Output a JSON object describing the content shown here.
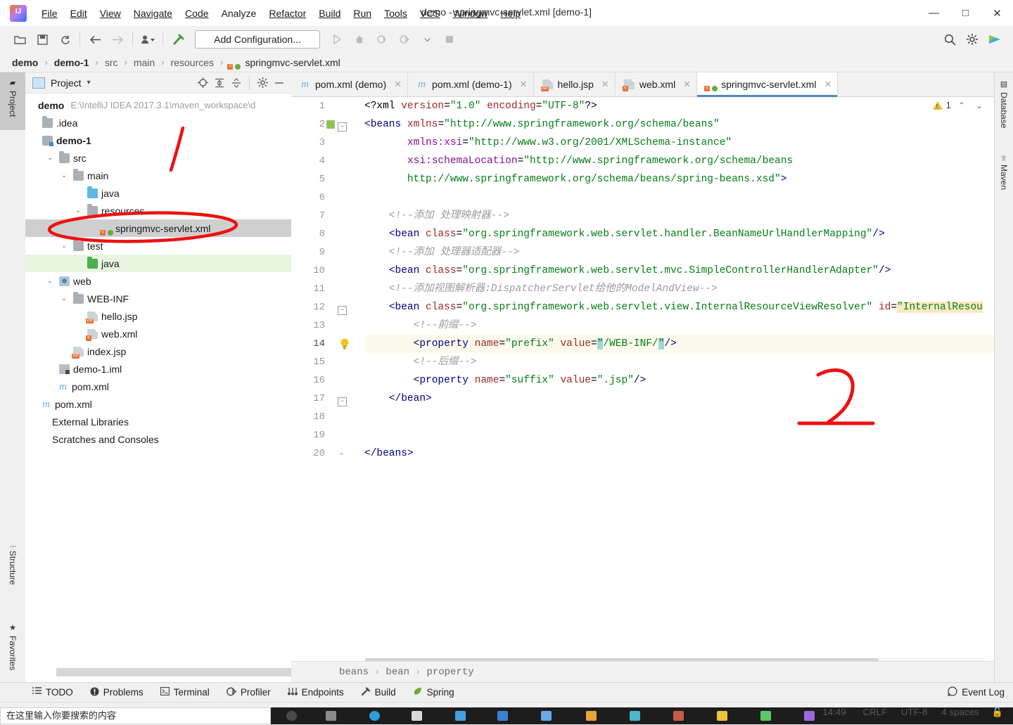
{
  "window": {
    "title": "demo - springmvc-servlet.xml [demo-1]",
    "minimize": "—",
    "maximize": "□",
    "close": "✕",
    "logo_text": "IJ"
  },
  "menubar": {
    "items": [
      "File",
      "Edit",
      "View",
      "Navigate",
      "Code",
      "Analyze",
      "Refactor",
      "Build",
      "Run",
      "Tools",
      "VCS",
      "Window",
      "Help"
    ]
  },
  "toolbar": {
    "open_icon": "open-folder-icon",
    "save_icon": "save-icon",
    "sync_icon": "sync-icon",
    "back_icon": "back-arrow-icon",
    "forward_icon": "forward-arrow-icon",
    "vcs_update_icon": "vcs-update-icon",
    "build_icon": "build-hammer-icon",
    "add_configuration": "Add Configuration...",
    "run_icon": "run-icon",
    "debug_icon": "debug-icon",
    "run_coverage_icon": "run-with-coverage-icon",
    "profile_icon": "profile-icon",
    "stop_icon": "stop-icon",
    "search_icon": "search-icon",
    "settings_icon": "gear-icon",
    "ide_icon": "ide-help-icon"
  },
  "breadcrumbs": {
    "items": [
      "demo",
      "demo-1",
      "src",
      "main",
      "resources",
      "springmvc-servlet.xml"
    ],
    "separator": "›"
  },
  "left_strip": {
    "tabs": [
      {
        "label": "Project",
        "icon": "project-icon",
        "selected": true
      },
      {
        "label": "Structure",
        "icon": "structure-icon",
        "selected": false
      },
      {
        "label": "Favorites",
        "icon": "star-icon",
        "selected": false
      }
    ]
  },
  "right_strip": {
    "tabs": [
      {
        "label": "Database",
        "icon": "database-icon"
      },
      {
        "label": "Maven",
        "icon": "maven-m-icon"
      }
    ]
  },
  "project_panel": {
    "title": "Project",
    "caret": "▾",
    "tools": [
      {
        "name": "select-opened-file-icon",
        "glyph": "⊕"
      },
      {
        "name": "expand-all-icon",
        "glyph": "⏩"
      },
      {
        "name": "collapse-all-icon",
        "glyph": "⏪"
      },
      {
        "name": "settings-gear-icon",
        "glyph": "⚙"
      },
      {
        "name": "hide-panel-icon",
        "glyph": "—"
      }
    ],
    "tree": [
      {
        "label": "demo",
        "path": "E:\\IntelliJ IDEA 2017.3.1\\maven_workspace\\d",
        "depth": 0,
        "arrow": "",
        "icon": "project-root",
        "bold": true
      },
      {
        "label": ".idea",
        "depth": 1,
        "arrow": "",
        "icon": "folder",
        "bold": false
      },
      {
        "label": "demo-1",
        "depth": 1,
        "arrow": "",
        "icon": "module",
        "bold": true
      },
      {
        "label": "src",
        "depth": 1,
        "arrow": "⌄",
        "icon": "folder",
        "bold": false
      },
      {
        "label": "main",
        "depth": 2,
        "arrow": "⌄",
        "icon": "folder",
        "bold": false
      },
      {
        "label": "java",
        "depth": 3,
        "arrow": "",
        "icon": "folder-blue",
        "bold": false
      },
      {
        "label": "resources",
        "depth": 3,
        "arrow": "⌄",
        "icon": "folder",
        "bold": false
      },
      {
        "label": "springmvc-servlet.xml",
        "depth": 4,
        "arrow": "",
        "icon": "spring-xml",
        "bold": false,
        "selected": true
      },
      {
        "label": "test",
        "depth": 2,
        "arrow": "⌄",
        "icon": "folder",
        "bold": false
      },
      {
        "label": "java",
        "depth": 3,
        "arrow": "",
        "icon": "folder-green",
        "bold": false,
        "green": true
      },
      {
        "label": "web",
        "depth": 1,
        "arrow": "⌄",
        "icon": "web-module",
        "bold": false
      },
      {
        "label": "WEB-INF",
        "depth": 2,
        "arrow": "⌄",
        "icon": "folder",
        "bold": false
      },
      {
        "label": "hello.jsp",
        "depth": 3,
        "arrow": "",
        "icon": "jsp",
        "bold": false
      },
      {
        "label": "web.xml",
        "depth": 3,
        "arrow": "",
        "icon": "xml",
        "bold": false
      },
      {
        "label": "index.jsp",
        "depth": 2,
        "arrow": "",
        "icon": "jsp",
        "bold": false
      },
      {
        "label": "demo-1.iml",
        "depth": 1,
        "arrow": "",
        "icon": "iml",
        "bold": false
      },
      {
        "label": "pom.xml",
        "depth": 1,
        "arrow": "",
        "icon": "maven-m",
        "bold": false
      },
      {
        "label": "pom.xml",
        "depth": 0,
        "arrow": "",
        "icon": "maven-m",
        "bold": false
      },
      {
        "label": "External Libraries",
        "depth": 0,
        "arrow": "",
        "icon": "none",
        "bold": false
      },
      {
        "label": "Scratches and Consoles",
        "depth": 0,
        "arrow": "",
        "icon": "none",
        "bold": false
      }
    ]
  },
  "editor": {
    "tabs": [
      {
        "label": "pom.xml (demo)",
        "icon": "maven-m",
        "active": false,
        "close": "✕"
      },
      {
        "label": "pom.xml (demo-1)",
        "icon": "maven-m",
        "active": false,
        "close": "✕"
      },
      {
        "label": "hello.jsp",
        "icon": "jsp",
        "active": false,
        "close": "✕"
      },
      {
        "label": "web.xml",
        "icon": "xml",
        "active": false,
        "close": "✕"
      },
      {
        "label": "springmvc-servlet.xml",
        "icon": "spring-xml",
        "active": true,
        "close": "✕"
      }
    ],
    "inspection": {
      "warning_count": "1",
      "up_arrow": "⌃",
      "down_arrow": "⌄"
    },
    "lines": [
      {
        "n": "1",
        "text": "<?xml version=\"1.0\" encoding=\"UTF-8\"?>"
      },
      {
        "n": "2",
        "text": "<beans xmlns=\"http://www.springframework.org/schema/beans\""
      },
      {
        "n": "3",
        "text": "       xmlns:xsi=\"http://www.w3.org/2001/XMLSchema-instance\""
      },
      {
        "n": "4",
        "text": "       xsi:schemaLocation=\"http://www.springframework.org/schema/beans"
      },
      {
        "n": "5",
        "text": "       http://www.springframework.org/schema/beans/spring-beans.xsd\">"
      },
      {
        "n": "6",
        "text": ""
      },
      {
        "n": "7",
        "text": "    <!--添加 处理映射器-->"
      },
      {
        "n": "8",
        "text": "    <bean class=\"org.springframework.web.servlet.handler.BeanNameUrlHandlerMapping\"/>"
      },
      {
        "n": "9",
        "text": "    <!--添加 处理器适配器-->"
      },
      {
        "n": "10",
        "text": "    <bean class=\"org.springframework.web.servlet.mvc.SimpleControllerHandlerAdapter\"/>"
      },
      {
        "n": "11",
        "text": "    <!--添加视图解析器:DispatcherServlet给他的ModelAndView-->"
      },
      {
        "n": "12",
        "text": "    <bean class=\"org.springframework.web.servlet.view.InternalResourceViewResolver\" id=\"InternalResou"
      },
      {
        "n": "13",
        "text": "        <!--前缀-->"
      },
      {
        "n": "14",
        "text": "        <property name=\"prefix\" value=\"/WEB-INF/\"/>"
      },
      {
        "n": "15",
        "text": "        <!--后缀-->"
      },
      {
        "n": "16",
        "text": "        <property name=\"suffix\" value=\".jsp\"/>"
      },
      {
        "n": "17",
        "text": "    </bean>"
      },
      {
        "n": "18",
        "text": ""
      },
      {
        "n": "19",
        "text": ""
      },
      {
        "n": "20",
        "text": "</beans>"
      }
    ],
    "current_line": "14",
    "bulb_icon": "intention-bulb-icon",
    "breadcrumb": {
      "items": [
        "beans",
        "bean",
        "property"
      ],
      "separator": "›"
    }
  },
  "bottom_bar": {
    "items": [
      {
        "label": "TODO",
        "icon": "todo-list-icon"
      },
      {
        "label": "Problems",
        "icon": "problems-icon"
      },
      {
        "label": "Terminal",
        "icon": "terminal-icon"
      },
      {
        "label": "Profiler",
        "icon": "profiler-icon"
      },
      {
        "label": "Endpoints",
        "icon": "endpoints-icon"
      },
      {
        "label": "Build",
        "icon": "build-hammer-icon"
      },
      {
        "label": "Spring",
        "icon": "spring-leaf-icon"
      }
    ],
    "event_log": {
      "label": "Event Log",
      "icon": "event-log-icon"
    }
  },
  "status": {
    "time": "14:49",
    "line_separator": "CRLF",
    "encoding": "UTF-8",
    "indent": "4 spaces",
    "lock_icon": "lock-icon"
  },
  "taskbar": {
    "search_placeholder": "在这里输入你要搜索的内容"
  },
  "colors": {
    "accent": "#4a86c8",
    "annotation_red": "#ee1111",
    "selection": "#cfcfcf",
    "string_green": "#067d17",
    "tag_blue": "#000081",
    "attr_red": "#9e2927",
    "comment_gray": "#9b9b9b",
    "warning_yellow": "#e8bb32"
  }
}
